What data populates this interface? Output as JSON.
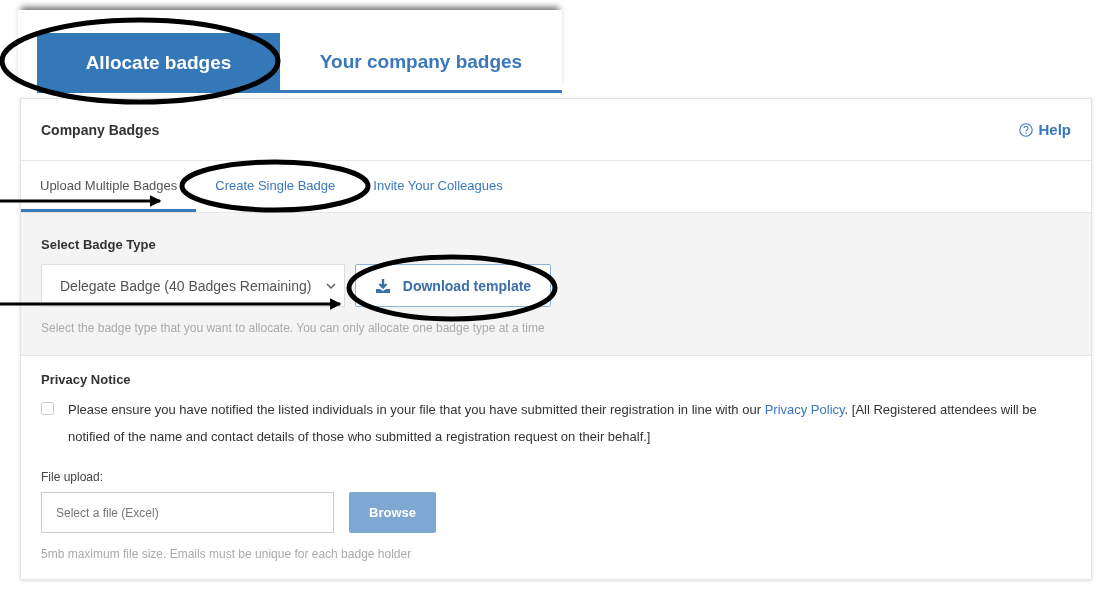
{
  "top_tabs": [
    {
      "label": "Allocate badges",
      "selected": true
    },
    {
      "label": "Your company badges",
      "selected": false
    }
  ],
  "panel": {
    "title": "Company Badges",
    "help": "Help"
  },
  "sub_tabs": [
    {
      "label": "Upload Multiple Badges",
      "selected": true
    },
    {
      "label": "Create Single Badge",
      "selected": false
    },
    {
      "label": "Invite Your Colleagues",
      "selected": false
    }
  ],
  "badge_type": {
    "label": "Select Badge Type",
    "value": "Delegate Badge (40 Badges Remaining)",
    "download_button": "Download template",
    "hint": "Select the badge type that you want to allocate. You can only allocate one badge type at a time"
  },
  "privacy": {
    "heading": "Privacy Notice",
    "checked": false,
    "text_before": "Please ensure you have notified the listed individuals in your file that you have submitted their registration in line with our ",
    "link": "Privacy Policy",
    "text_after": ". [All Registered attendees will be notified of the name and contact details of those who submitted a registration request on their behalf.]"
  },
  "file_upload": {
    "label": "File upload:",
    "placeholder": "Select a file (Excel)",
    "browse_button": "Browse",
    "disabled": true,
    "hint": "5mb maximum file size. Emails must be unique for each badge holder"
  }
}
